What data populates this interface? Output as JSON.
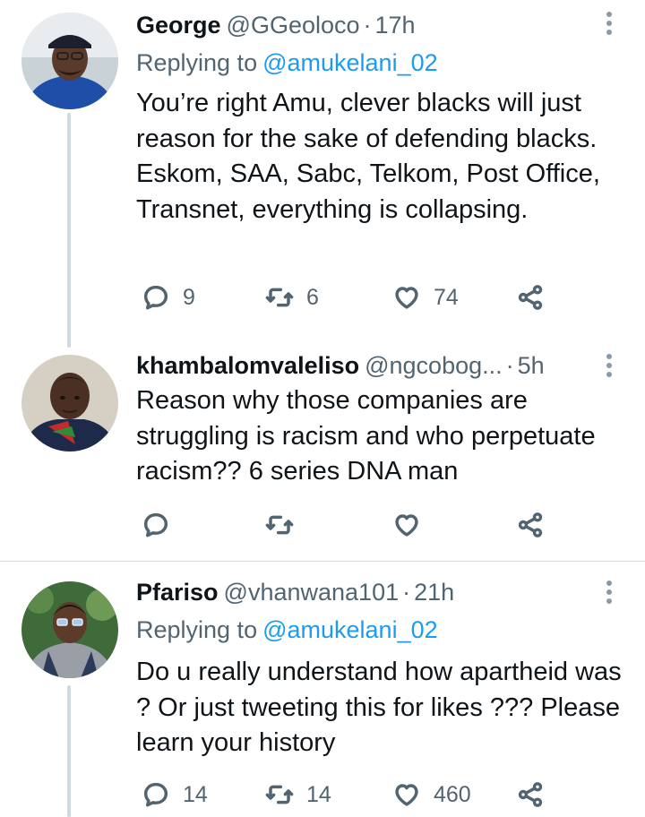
{
  "tweets": [
    {
      "name": "George",
      "handle": "@GGeoloco",
      "time": "17h",
      "replying_label": "Replying to",
      "replying_to": "@amukelani_02",
      "text": "You’re right Amu, clever blacks will just reason for the sake of defending blacks. Eskom, SAA, Sabc, Telkom, Post Office, Transnet, everything is collapsing.",
      "replies": "9",
      "retweets": "6",
      "likes": "74"
    },
    {
      "name": "khambalomvaleliso",
      "handle": "@ngcobog...",
      "time": "5h",
      "text": "Reason why those companies are struggling is racism and who perpetuate racism?? 6 series DNA man",
      "replies": "",
      "retweets": "",
      "likes": ""
    },
    {
      "name": "Pfariso",
      "handle": "@vhanwana101",
      "time": "21h",
      "replying_label": "Replying to",
      "replying_to": "@amukelani_02",
      "text": "Do u really understand how apartheid was ? Or just tweeting this for likes ??? Please learn your history",
      "replies": "14",
      "retweets": "14",
      "likes": "460"
    }
  ],
  "separator": "·",
  "colors": {
    "text": "#0f1419",
    "muted": "#536471",
    "link": "#1d9bf0",
    "thread_line": "#cfd9de"
  },
  "icons": [
    "reply-icon",
    "retweet-icon",
    "like-icon",
    "share-icon",
    "more-options-icon"
  ]
}
